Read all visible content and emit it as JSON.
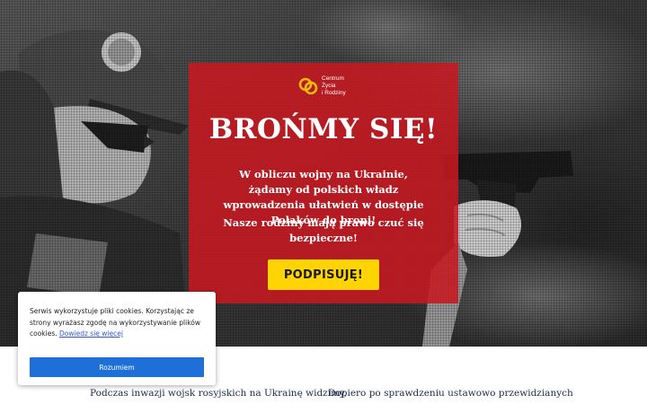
{
  "hero": {
    "brand": {
      "logo_icon": "linked-rings-logo-icon",
      "line1": "Centrum",
      "line2": "Życia",
      "line3": "i Rodziny"
    },
    "title": "BROŃMY SIĘ!",
    "lead": "W obliczu wojny na Ukrainie, żądamy od polskich władz wprowadzenia ułatwień w dostępie Polaków do broni!",
    "safety": "Nasze rodziny mają prawo czuć się bezpieczne!",
    "sign_button": "PODPISUJĘ!",
    "colors": {
      "panel": "#c61820",
      "button": "#ffd400",
      "logo": "#f2b90f"
    }
  },
  "cookie": {
    "text": "Serwis wykorzystuje pliki cookies. Korzystając ze strony wyrażasz zgodę na wykorzystywanie plików cookies.",
    "link": "Dowiedz się więcej",
    "accept_button": "Rozumiem",
    "colors": {
      "button": "#1f6fd8",
      "link": "#2f5ad6"
    }
  },
  "article": {
    "left_text": "Podczas inwazji wojsk rosyjskich na Ukrainę widzimy,",
    "right_text": "Dopiero po sprawdzeniu ustawowo przewidzianych"
  }
}
